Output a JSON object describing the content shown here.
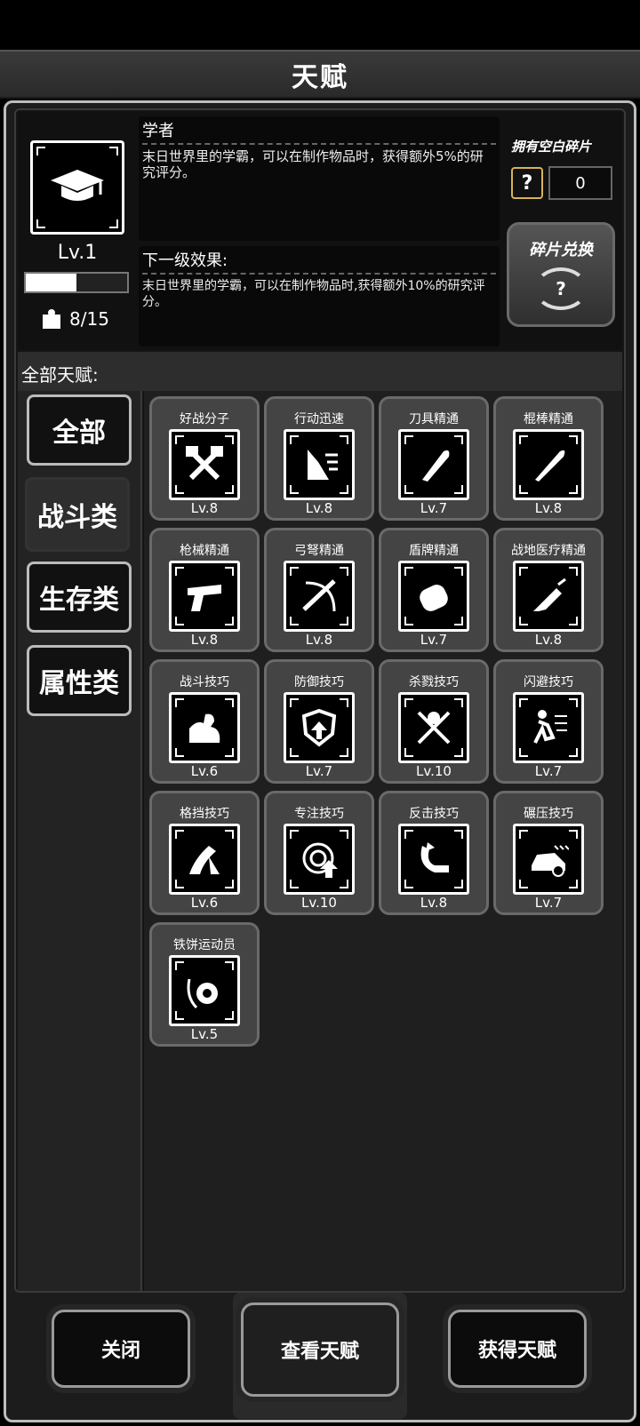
{
  "header": {
    "title": "天赋"
  },
  "selected": {
    "icon": "graduation-cap-icon",
    "level": "Lv.1",
    "xp_fraction": 0.5,
    "fragments": "8/15",
    "name": "学者",
    "description": "末日世界里的学霸，可以在制作物品时，获得额外5%的研究评分。",
    "next_title": "下一级效果:",
    "next_description": "末日世界里的学霸，可以在制作物品时,获得额外10%的研究评分。"
  },
  "blank_fragments": {
    "label": "拥有空白碎片",
    "icon_text": "?",
    "count": "0"
  },
  "exchange": {
    "label": "碎片兑换",
    "icon_text": "?"
  },
  "all_talents_label": "全部天赋:",
  "categories": [
    {
      "label": "全部",
      "active": false
    },
    {
      "label": "战斗类",
      "active": true
    },
    {
      "label": "生存类",
      "active": false
    },
    {
      "label": "属性类",
      "active": false
    }
  ],
  "talents": [
    {
      "name": "好战分子",
      "level": "Lv.8",
      "icon": "crossed-axes-icon"
    },
    {
      "name": "行动迅速",
      "level": "Lv.8",
      "icon": "running-leg-icon"
    },
    {
      "name": "刀具精通",
      "level": "Lv.7",
      "icon": "machete-icon"
    },
    {
      "name": "棍棒精通",
      "level": "Lv.8",
      "icon": "bat-icon"
    },
    {
      "name": "枪械精通",
      "level": "Lv.8",
      "icon": "pistol-icon"
    },
    {
      "name": "弓弩精通",
      "level": "Lv.8",
      "icon": "crossbow-icon"
    },
    {
      "name": "盾牌精通",
      "level": "Lv.7",
      "icon": "shield-icon"
    },
    {
      "name": "战地医疗精通",
      "level": "Lv.8",
      "icon": "syringe-icon"
    },
    {
      "name": "战斗技巧",
      "level": "Lv.6",
      "icon": "flexed-arm-icon"
    },
    {
      "name": "防御技巧",
      "level": "Lv.7",
      "icon": "defense-shield-icon"
    },
    {
      "name": "杀戮技巧",
      "level": "Lv.10",
      "icon": "crossed-swords-icon"
    },
    {
      "name": "闪避技巧",
      "level": "Lv.7",
      "icon": "dodge-runner-icon"
    },
    {
      "name": "格挡技巧",
      "level": "Lv.6",
      "icon": "block-arm-icon"
    },
    {
      "name": "专注技巧",
      "level": "Lv.10",
      "icon": "target-icon"
    },
    {
      "name": "反击技巧",
      "level": "Lv.8",
      "icon": "counter-arm-icon"
    },
    {
      "name": "碾压技巧",
      "level": "Lv.7",
      "icon": "car-crash-icon"
    },
    {
      "name": "铁饼运动员",
      "level": "Lv.5",
      "icon": "discus-icon"
    }
  ],
  "buttons": {
    "close": "关闭",
    "view": "查看天赋",
    "get": "获得天赋"
  }
}
